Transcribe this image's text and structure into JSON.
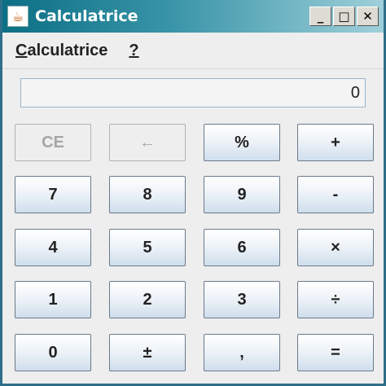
{
  "window": {
    "title": "Calculatrice",
    "controls": {
      "minimize": "_",
      "maximize": "□",
      "close": "✕"
    },
    "icon": "java-icon"
  },
  "menu": {
    "items": [
      {
        "mnemonic": "C",
        "rest": "alculatrice"
      },
      {
        "mnemonic": "?",
        "rest": ""
      }
    ]
  },
  "display": {
    "value": "0"
  },
  "keys": {
    "row1": [
      {
        "label": "CE",
        "enabled": false
      },
      {
        "label": "←",
        "enabled": false
      },
      {
        "label": "%",
        "enabled": true
      },
      {
        "label": "+",
        "enabled": true
      }
    ],
    "row2": [
      {
        "label": "7",
        "enabled": true
      },
      {
        "label": "8",
        "enabled": true
      },
      {
        "label": "9",
        "enabled": true
      },
      {
        "label": "-",
        "enabled": true
      }
    ],
    "row3": [
      {
        "label": "4",
        "enabled": true
      },
      {
        "label": "5",
        "enabled": true
      },
      {
        "label": "6",
        "enabled": true
      },
      {
        "label": "×",
        "enabled": true
      }
    ],
    "row4": [
      {
        "label": "1",
        "enabled": true
      },
      {
        "label": "2",
        "enabled": true
      },
      {
        "label": "3",
        "enabled": true
      },
      {
        "label": "÷",
        "enabled": true
      }
    ],
    "row5": [
      {
        "label": "0",
        "enabled": true
      },
      {
        "label": "±",
        "enabled": true
      },
      {
        "label": ",",
        "enabled": true
      },
      {
        "label": "=",
        "enabled": true
      }
    ]
  }
}
